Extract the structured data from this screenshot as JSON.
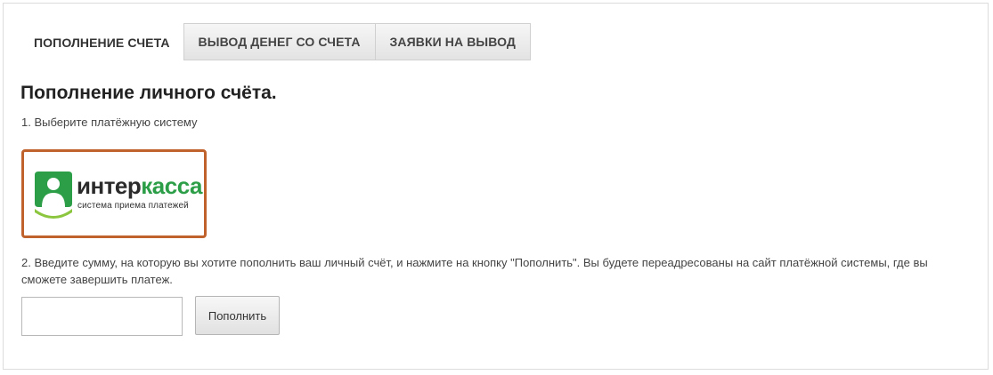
{
  "tabs": [
    {
      "label": "ПОПОЛНЕНИЕ СЧЕТА",
      "active": true
    },
    {
      "label": "ВЫВОД ДЕНЕГ СО СЧЕТА",
      "active": false
    },
    {
      "label": "ЗАЯВКИ НА ВЫВОД",
      "active": false
    }
  ],
  "main": {
    "heading": "Пополнение личного счёта.",
    "step1": "1. Выберите платёжную систему",
    "payment_system": {
      "icon": "interkassa-person-icon",
      "name_dark": "интер",
      "name_green": "касса",
      "tagline": "система приема платежей",
      "selected_border_color": "#c0622b",
      "brand_color": "#2d9e48"
    },
    "step2": "2. Введите сумму, на которую вы хотите пополнить ваш личный счёт, и нажмите на кнопку \"Пополнить\". Вы будете переадресованы на сайт платёжной системы, где вы сможете завершить платеж.",
    "amount_input": {
      "value": "",
      "placeholder": ""
    },
    "submit_label": "Пополнить"
  }
}
